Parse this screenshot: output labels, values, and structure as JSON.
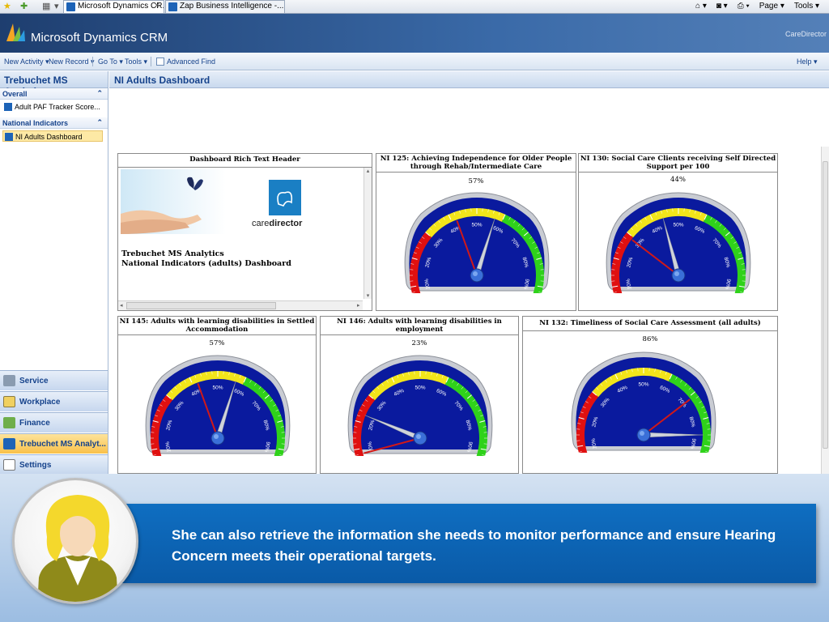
{
  "browser": {
    "tabs": [
      {
        "label": "Microsoft Dynamics CR...",
        "active": true
      },
      {
        "label": "Zap Business Intelligence -...",
        "active": false
      }
    ],
    "right_tools": [
      "Page ▾",
      "Tools ▾"
    ]
  },
  "app": {
    "title": "Microsoft Dynamics CRM",
    "org": "CareDirector"
  },
  "command_bar": {
    "items": [
      "New Activity ▾",
      "New Record ▾",
      "Go To ▾",
      "Tools ▾",
      "Advanced Find"
    ],
    "help": "Help ▾"
  },
  "leftnav": {
    "title": "Trebuchet MS Analytics",
    "sections": [
      {
        "label": "Overall",
        "items": [
          "Adult PAF Tracker Score..."
        ]
      },
      {
        "label": "National Indicators",
        "items": [
          "NI Adults Dashboard"
        ]
      }
    ],
    "wunderbar": [
      "Service",
      "Workplace",
      "Finance",
      "Trebuchet MS Analyt...",
      "Settings"
    ]
  },
  "content": {
    "title": "NI Adults Dashboard"
  },
  "rich_text": {
    "header": "Dashboard Rich Text Header",
    "brand_prefix": "care",
    "brand_suffix": "director",
    "line1": "Trebuchet MS Analytics",
    "line2": "National Indicators (adults) Dashboard"
  },
  "gauges": [
    {
      "title": "NI 125: Achieving Independence for Older People through Rehab/Intermediate Care",
      "percent_label": "57%",
      "value": 57
    },
    {
      "title": "NI 130: Social Care Clients receiving Self Directed Support per 100",
      "percent_label": "44%",
      "value": 44
    },
    {
      "title": "NI 145: Adults with learning disabilities in Settled Accommodation",
      "percent_label": "57%",
      "value": 57
    },
    {
      "title": "NI 146: Adults with learning disabilities in employment",
      "percent_label": "23%",
      "value": 23
    },
    {
      "title": "NI 132: Timeliness of Social Care Assessment (all adults)",
      "percent_label": "86%",
      "value": 86
    }
  ],
  "gauge_scale": {
    "ticks": [
      "0%",
      "10%",
      "20%",
      "30%",
      "40%",
      "50%",
      "60%",
      "70%",
      "80%",
      "90%",
      "100%"
    ],
    "bands": [
      {
        "from": 0,
        "to": 30,
        "color": "#e01010"
      },
      {
        "from": 30,
        "to": 60,
        "color": "#f2e51a"
      },
      {
        "from": 60,
        "to": 100,
        "color": "#2fd21a"
      }
    ],
    "face_color": "#0a1a9e"
  },
  "caption": {
    "text": "She can also retrieve the information she needs to monitor performance and ensure Hearing Concern meets their operational targets."
  }
}
